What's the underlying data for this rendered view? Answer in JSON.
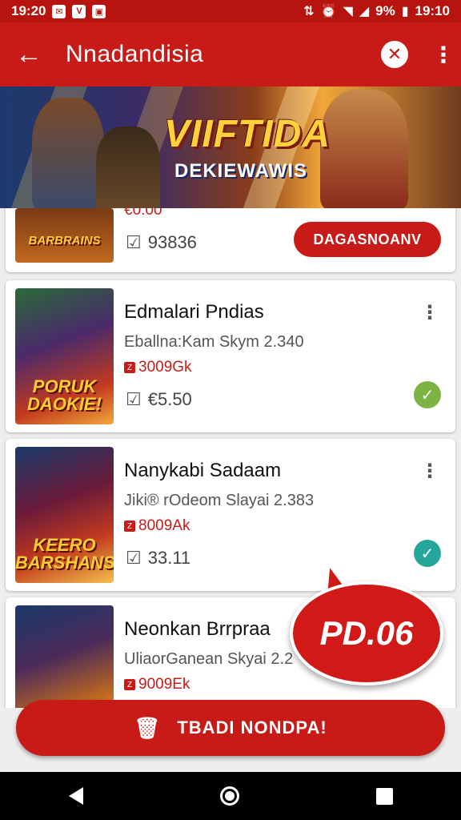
{
  "status_bar": {
    "time_left": "19:20",
    "battery": "9%",
    "time_right": "19:10"
  },
  "app_bar": {
    "title": "Nnadandisia"
  },
  "banner": {
    "title": "VIIFTIDA",
    "subtitle": "DEKIEWAWIS"
  },
  "cards": [
    {
      "thumb_caption": "BARBRAINS",
      "price": "€0.00",
      "date": "93836",
      "action_label": "DAGASNOANV"
    },
    {
      "title": "Edmalari Pndias",
      "subtitle": "Eballna:Kam Skym 2.340",
      "price": "3009Gk",
      "date": "€5.50",
      "thumb_caption": "PORUK DAOKIE!"
    },
    {
      "title": "Nanykabi Sadaam",
      "subtitle": "Jiki® rOdeom Slayai 2.383",
      "price": "8009Ak",
      "date": "33.11",
      "thumb_caption": "KEERO BARSHANS"
    },
    {
      "title": "Neonkan Brrpraa",
      "subtitle": "UliaorGanean Skyai 2.2",
      "price": "9009Ek"
    }
  ],
  "promo": {
    "label": "PD.06"
  },
  "bottom_action": {
    "label": "TBADI NONDPA!"
  },
  "colors": {
    "primary": "#c81b17",
    "status_bar": "#b71410",
    "check_green": "#7cb342",
    "check_teal": "#26a69a"
  }
}
